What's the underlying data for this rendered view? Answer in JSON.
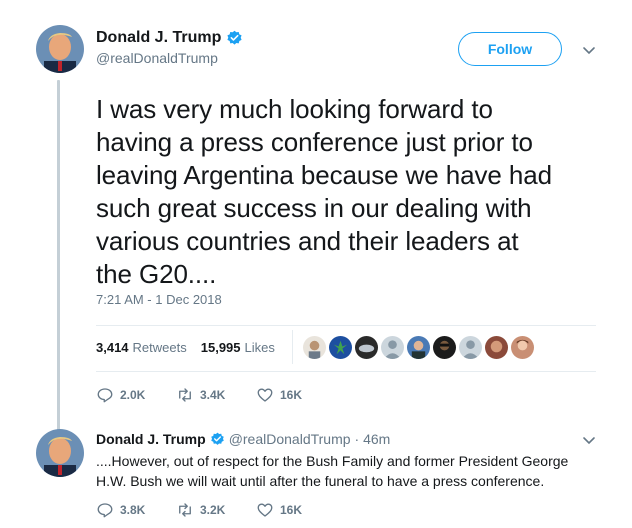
{
  "tweet": {
    "author_name": "Donald J. Trump",
    "handle": "@realDonaldTrump",
    "follow_label": "Follow",
    "text": "I was very much looking forward to\nhaving a press conference just prior to\nleaving Argentina because we have had\nsuch great success in our dealing with\nvarious countries and their leaders at\nthe G20....",
    "timestamp": "7:21 AM - 1 Dec 2018",
    "retweets_count": "3,414",
    "retweets_label": "Retweets",
    "likes_count": "15,995",
    "likes_label": "Likes",
    "actions": {
      "replies": "2.0K",
      "retweets": "3.4K",
      "likes": "16K"
    }
  },
  "reply": {
    "author_name": "Donald J. Trump",
    "handle": "@realDonaldTrump",
    "time": "· 46m",
    "text": "....However, out of respect for the Bush Family and former President George H.W. Bush we will wait until after the funeral to have a press conference.",
    "actions": {
      "replies": "3.8K",
      "retweets": "3.2K",
      "likes": "16K"
    }
  },
  "icons": {
    "verified": "verified-badge-icon",
    "caret": "chevron-down-icon",
    "reply": "reply-icon",
    "retweet": "retweet-icon",
    "like": "heart-icon"
  },
  "colors": {
    "accent": "#1da1f2",
    "text": "#14171a",
    "muted": "#657786",
    "thread_line": "#c4cfd6"
  }
}
